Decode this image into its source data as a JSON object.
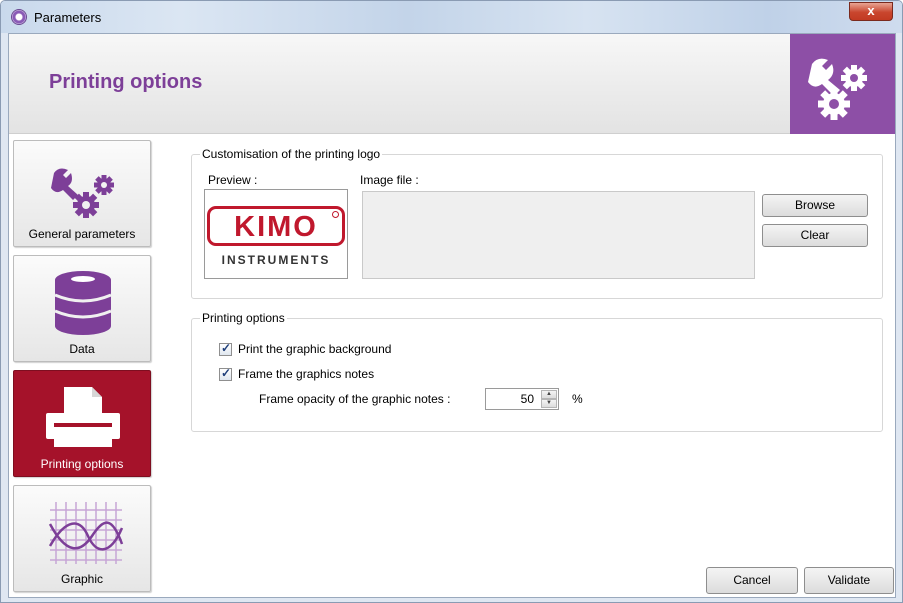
{
  "window": {
    "title": "Parameters",
    "close_label": "x"
  },
  "header": {
    "title": "Printing options"
  },
  "nav": {
    "items": [
      {
        "label": "General parameters",
        "icon": "gears-icon"
      },
      {
        "label": "Data",
        "icon": "database-icon"
      },
      {
        "label": "Printing options",
        "icon": "printer-icon",
        "active": true
      },
      {
        "label": "Graphic",
        "icon": "graph-icon"
      }
    ]
  },
  "logo_group": {
    "title": "Customisation of the printing logo",
    "preview_label": "Preview :",
    "image_file_label": "Image file :",
    "logo_text": "KIMO",
    "logo_subtext": "INSTRUMENTS",
    "browse_label": "Browse",
    "clear_label": "Clear"
  },
  "print_group": {
    "title": "Printing options",
    "print_background_label": "Print the graphic background",
    "print_background_checked": true,
    "frame_notes_label": "Frame the graphics notes",
    "frame_notes_checked": true,
    "opacity_label": "Frame opacity of the graphic notes :",
    "opacity_value": "50",
    "opacity_unit": "%"
  },
  "footer": {
    "cancel_label": "Cancel",
    "validate_label": "Validate"
  },
  "colors": {
    "brand_purple": "#7d3f98",
    "active_red": "#a5122a"
  }
}
